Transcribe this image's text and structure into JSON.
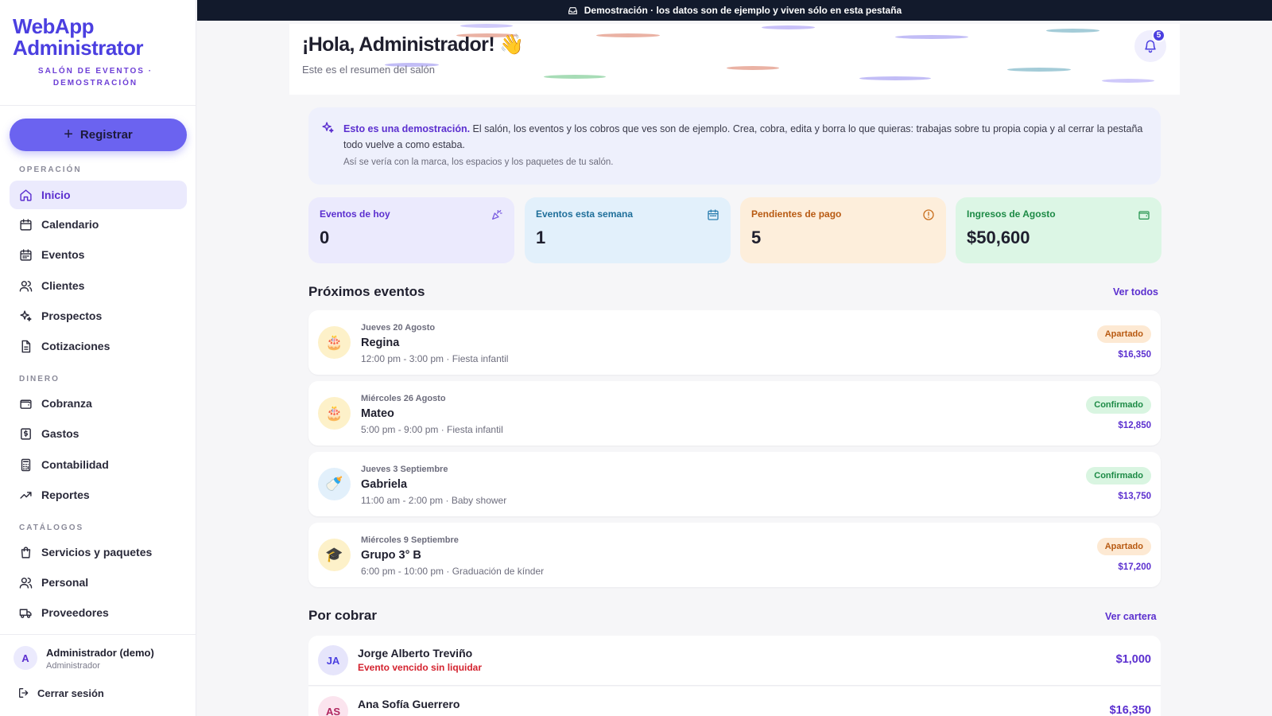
{
  "sidebar": {
    "brand_title": "WebApp Administrator",
    "brand_subtitle": "SALÓN DE EVENTOS · DEMOSTRACIÓN",
    "register_label": "Registrar",
    "sections": {
      "operacion": "OPERACIÓN",
      "dinero": "DINERO",
      "catalogos": "CATÁLOGOS"
    },
    "items": {
      "inicio": "Inicio",
      "calendario": "Calendario",
      "eventos": "Eventos",
      "clientes": "Clientes",
      "prospectos": "Prospectos",
      "cotizaciones": "Cotizaciones",
      "cobranza": "Cobranza",
      "gastos": "Gastos",
      "contabilidad": "Contabilidad",
      "reportes": "Reportes",
      "servicios": "Servicios y paquetes",
      "personal": "Personal",
      "proveedores": "Proveedores"
    },
    "user": {
      "initial": "A",
      "name": "Administrador (demo)",
      "role": "Administrador",
      "logout_label": "Cerrar sesión"
    }
  },
  "topbar": {
    "text": "Demostración · los datos son de ejemplo y viven sólo en esta pestaña"
  },
  "header": {
    "greeting": "¡Hola, Administrador! 👋",
    "subtitle": "Este es el resumen del salón",
    "notifications_count": "5"
  },
  "notice": {
    "strong": "Esto es una demostración.",
    "text": " El salón, los eventos y los cobros que ves son de ejemplo. Crea, cobra, edita y borra lo que quieras: trabajas sobre tu propia copia y al cerrar la pestaña todo vuelve a como estaba.",
    "sub": "Así se vería con la marca, los espacios y los paquetes de tu salón."
  },
  "stats": [
    {
      "label": "Eventos de hoy",
      "value": "0"
    },
    {
      "label": "Eventos esta semana",
      "value": "1"
    },
    {
      "label": "Pendientes de pago",
      "value": "5"
    },
    {
      "label": "Ingresos de Agosto",
      "value": "$50,600"
    }
  ],
  "upcoming": {
    "title": "Próximos eventos",
    "link": "Ver todos",
    "events": [
      {
        "icon": "cake-icon",
        "glyph": "🎂",
        "date": "Jueves 20 Agosto",
        "name": "Regina",
        "detail": "12:00 pm - 3:00 pm · Fiesta infantil",
        "status": "Apartado",
        "amount": "$16,350"
      },
      {
        "icon": "cake-icon",
        "glyph": "🎂",
        "date": "Miércoles 26 Agosto",
        "name": "Mateo",
        "detail": "5:00 pm - 9:00 pm · Fiesta infantil",
        "status": "Confirmado",
        "amount": "$12,850"
      },
      {
        "icon": "baby-bottle-icon",
        "glyph": "🍼",
        "date": "Jueves 3 Septiembre",
        "name": "Gabriela",
        "detail": "11:00 am - 2:00 pm · Baby shower",
        "status": "Confirmado",
        "amount": "$13,750"
      },
      {
        "icon": "graduation-cap-icon",
        "glyph": "🎓",
        "date": "Miércoles 9 Septiembre",
        "name": "Grupo 3° B",
        "detail": "6:00 pm - 10:00 pm · Graduación de kínder",
        "status": "Apartado",
        "amount": "$17,200"
      }
    ]
  },
  "receivables": {
    "title": "Por cobrar",
    "link": "Ver cartera",
    "items": [
      {
        "initials": "JA",
        "name": "Jorge Alberto Treviño",
        "status": "Evento vencido sin liquidar",
        "amount": "$1,000"
      },
      {
        "initials": "AS",
        "name": "Ana Sofía Guerrero",
        "status": "",
        "amount": "$16,350"
      }
    ]
  },
  "colors": {
    "accent": "#5b2fcf",
    "brand": "#4b3fe0",
    "banner": "#121a2c"
  }
}
